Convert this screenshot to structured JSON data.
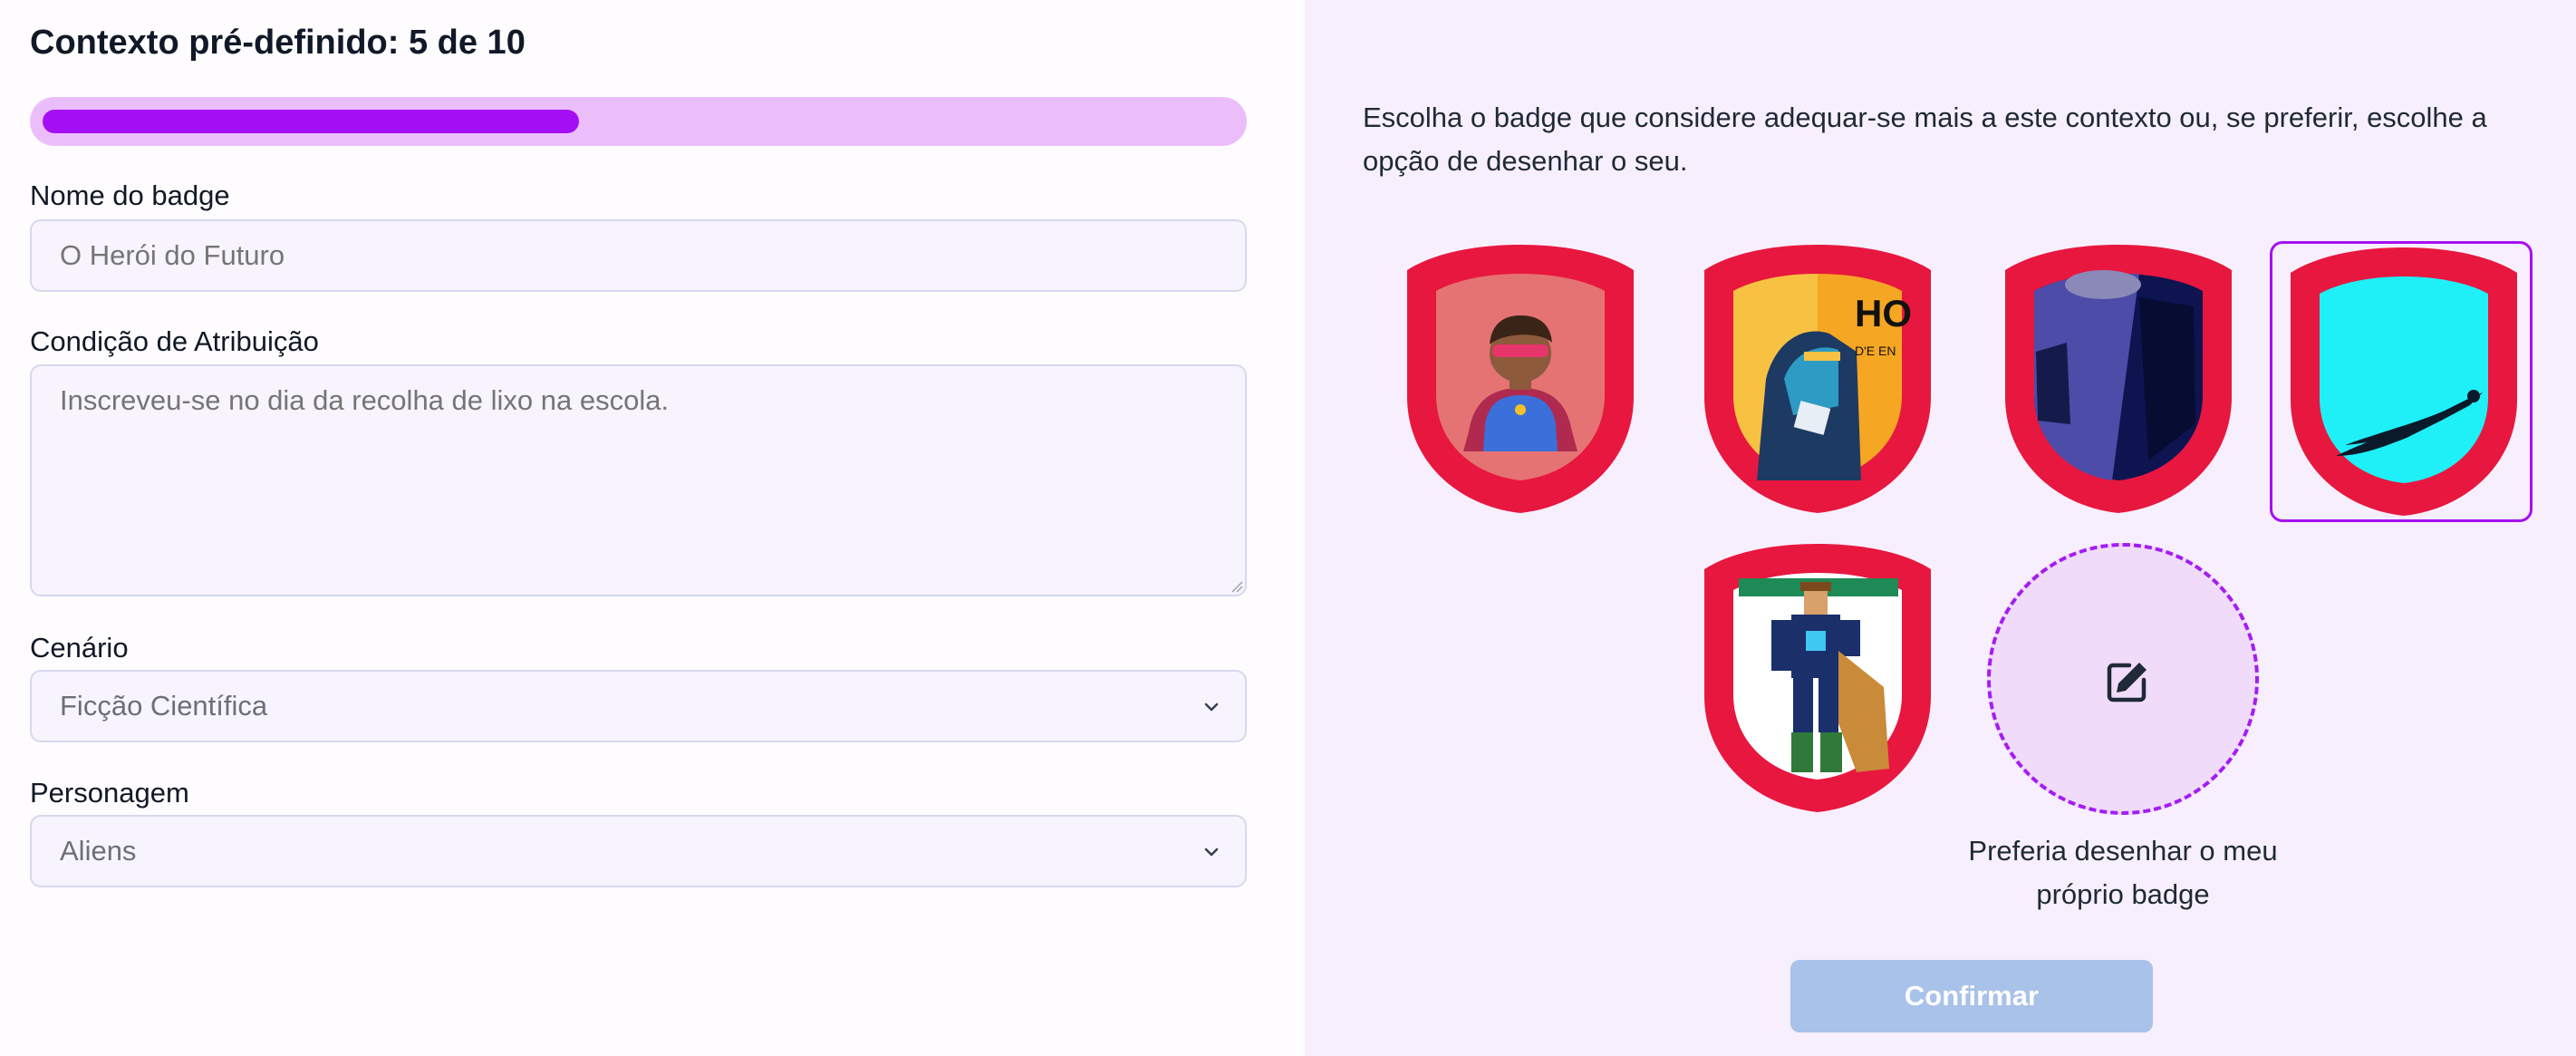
{
  "header": {
    "title": "Contexto pré-definido: 5 de 10"
  },
  "progress": {
    "current": 5,
    "total": 10,
    "fraction": 0.45
  },
  "form": {
    "name_label": "Nome do badge",
    "name_placeholder": "O Herói do Futuro",
    "condition_label": "Condição de Atribuição",
    "condition_placeholder": "Inscreveu-se no dia da recolha de lixo na escola.",
    "scenario_label": "Cenário",
    "scenario_value": "Ficção Científica",
    "character_label": "Personagem",
    "character_value": "Aliens"
  },
  "gallery": {
    "instruction": "Escolha o badge que considere adequar-se mais a este contexto ou, se preferir, escolhe a opção de desenhar o seu.",
    "selected_index": 3,
    "badges": [
      {
        "name": "superhero-avatar-badge",
        "frame_color": "#e8173f",
        "fill_color": "#e57373"
      },
      {
        "name": "comic-hero-badge",
        "frame_color": "#e8173f",
        "fill_color": "#f5a623"
      },
      {
        "name": "dark-robot-badge",
        "frame_color": "#e8173f",
        "fill_color": "#1e2a6b"
      },
      {
        "name": "flying-hero-badge",
        "frame_color": "#e8173f",
        "fill_color": "#1ff0f7"
      },
      {
        "name": "pixel-hero-badge",
        "frame_color": "#e8173f",
        "fill_color": "#ffffff"
      }
    ],
    "draw_option_label": "Preferia desenhar o meu próprio badge",
    "draw_icon": "edit-pencil-icon"
  },
  "actions": {
    "confirm_label": "Confirmar",
    "confirm_color": "#a9c2e9"
  },
  "colors": {
    "accent": "#a50ff5",
    "progress_track": "#ebbefb",
    "badge_frame": "#e8173f",
    "panel_bg": "#f7effd"
  }
}
